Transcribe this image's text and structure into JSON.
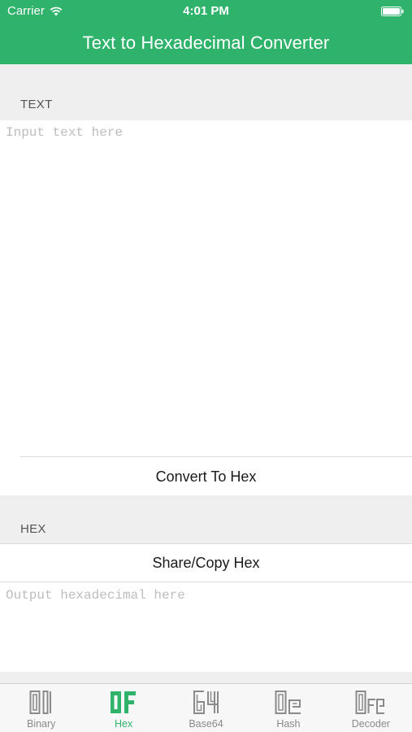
{
  "status_bar": {
    "carrier": "Carrier",
    "time": "4:01 PM"
  },
  "header": {
    "title": "Text to Hexadecimal Converter"
  },
  "text_section": {
    "label": "TEXT",
    "input_placeholder": "Input text here",
    "input_value": "",
    "convert_label": "Convert To Hex"
  },
  "hex_section": {
    "label": "HEX",
    "share_label": "Share/Copy Hex",
    "output_placeholder": "Output hexadecimal here",
    "output_value": ""
  },
  "tabs": [
    {
      "label": "Binary",
      "icon": "binary-icon",
      "active": false
    },
    {
      "label": "Hex",
      "icon": "hex-icon",
      "active": true
    },
    {
      "label": "Base64",
      "icon": "base64-icon",
      "active": false
    },
    {
      "label": "Hash",
      "icon": "hash-icon",
      "active": false
    },
    {
      "label": "Decoder",
      "icon": "decoder-icon",
      "active": false
    }
  ],
  "colors": {
    "accent": "#2fb36b",
    "background": "#efefef",
    "inactive_tab": "#8a8a8a"
  }
}
